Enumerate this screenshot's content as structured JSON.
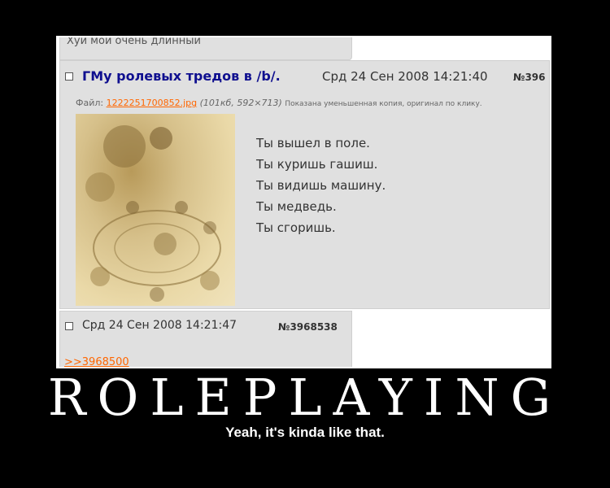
{
  "screenshot": {
    "top_post_text": "Хуй мой очень длинный",
    "post": {
      "title": "ГМу ролевых тредов в /b/.",
      "date": "Срд 24 Сен 2008 14:21:40",
      "number": "№396",
      "file_label": "Файл:",
      "file_name": "1222251700852.jpg",
      "file_meta": "(101кб, 592×713)",
      "file_note": "Показана уменьшенная копия, оригинал по клику.",
      "message_lines": [
        "Ты вышел в поле.",
        "Ты куришь гашиш.",
        "Ты видишь машину.",
        "Ты медведь.",
        "Ты сгоришь."
      ]
    },
    "reply_post": {
      "date": "Срд 24 Сен 2008 14:21:47",
      "number": "№3968538",
      "reply_link": ">>3968500"
    }
  },
  "poster": {
    "headline": "ROLEPLAYING",
    "tagline": "Yeah, it's kinda like that."
  },
  "colors": {
    "background": "#000000",
    "post_bg": "#e0e0e0",
    "title": "#0f0f8f",
    "link": "#ff6600"
  }
}
